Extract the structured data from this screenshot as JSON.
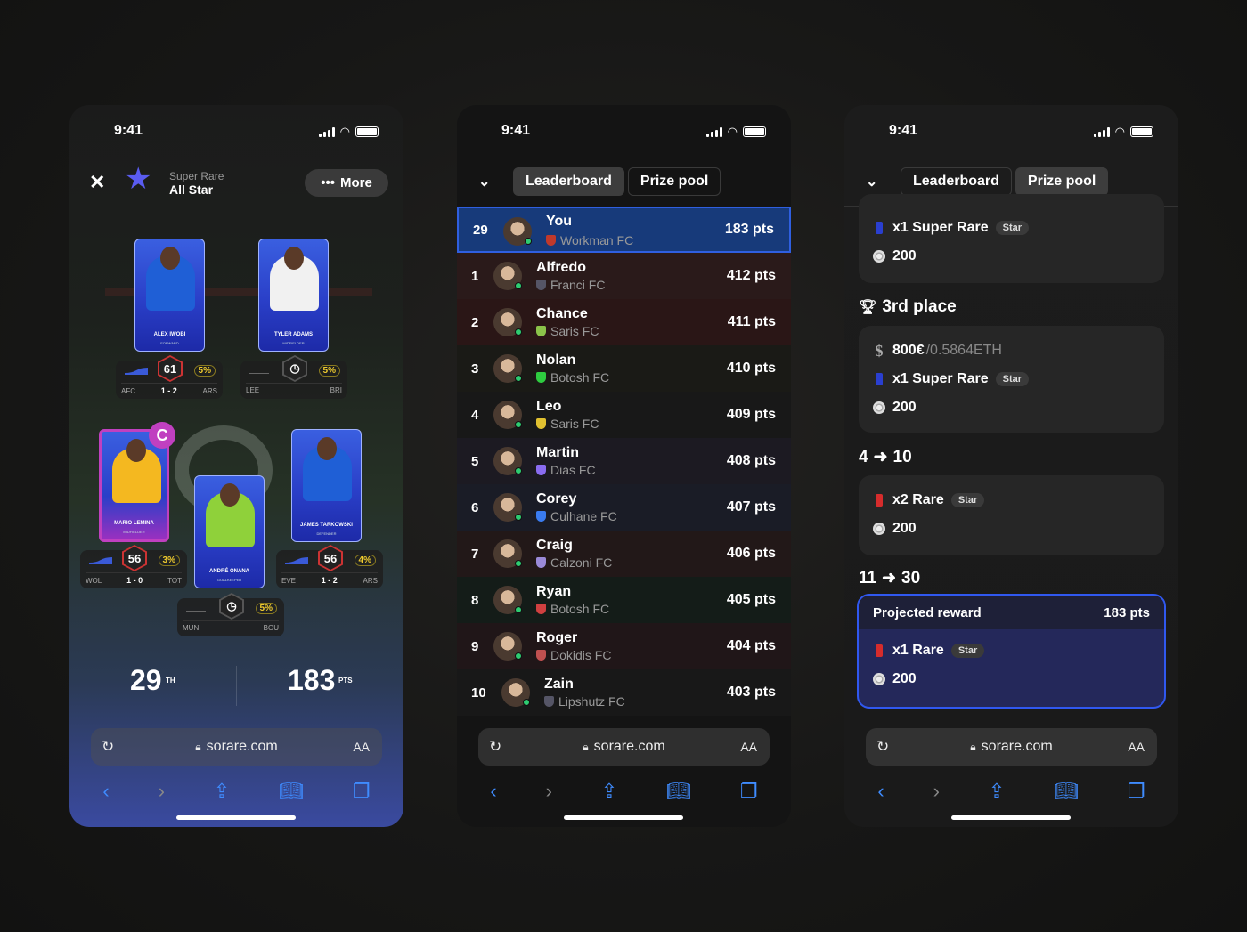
{
  "status": {
    "time": "9:41"
  },
  "browser": {
    "url": "sorare.com",
    "aa": "AA",
    "reload_icon": "reload-icon",
    "lock_icon": "lock-icon"
  },
  "lineup": {
    "rarity": "Super Rare",
    "competition": "All Star",
    "more_label": "More",
    "more_icon": "ellipsis-icon",
    "captain_badge": "C",
    "players": [
      {
        "name": "ALEX IWOBI",
        "position": "FORWARD",
        "score": "61",
        "pct": "5%",
        "home": "AFC",
        "result": "1 - 2",
        "away": "ARS",
        "jersey": "#1f5fd6"
      },
      {
        "name": "TYLER ADAMS",
        "position": "MIDFIELDER",
        "score": "",
        "pct": "5%",
        "home": "LEE",
        "result": "",
        "away": "BRI",
        "jersey": "#f1f1f1"
      },
      {
        "name": "MARIO LEMINA",
        "position": "MIDFIELDER",
        "score": "56",
        "pct": "3%",
        "home": "WOL",
        "result": "1 - 0",
        "away": "TOT",
        "jersey": "#f4b820"
      },
      {
        "name": "ANDRÉ ONANA",
        "position": "GOALKEEPER",
        "score": "",
        "pct": "5%",
        "home": "MUN",
        "result": "",
        "away": "BOU",
        "jersey": "#8fd13a"
      },
      {
        "name": "JAMES TARKOWSKI",
        "position": "DEFENDER",
        "score": "56",
        "pct": "4%",
        "home": "EVE",
        "result": "1 - 2",
        "away": "ARS",
        "jersey": "#1f5fd6"
      }
    ],
    "rank": "29",
    "rank_suffix": "TH",
    "points": "183",
    "points_suffix": "PTS"
  },
  "tabs": {
    "leaderboard": "Leaderboard",
    "prize_pool": "Prize pool"
  },
  "leaderboard": [
    {
      "rank": "29",
      "name": "You",
      "club": "Workman FC",
      "pts": "183 pts",
      "crest": "#c0392b",
      "me": true
    },
    {
      "rank": "1",
      "name": "Alfredo",
      "club": "Franci FC",
      "pts": "412 pts",
      "crest": "#556"
    },
    {
      "rank": "2",
      "name": "Chance",
      "club": "Saris FC",
      "pts": "411 pts",
      "crest": "#8bc34a"
    },
    {
      "rank": "3",
      "name": "Nolan",
      "club": "Botosh FC",
      "pts": "410 pts",
      "crest": "#2ecc40"
    },
    {
      "rank": "4",
      "name": "Leo",
      "club": "Saris FC",
      "pts": "409 pts",
      "crest": "#e0c030"
    },
    {
      "rank": "5",
      "name": "Martin",
      "club": "Dias FC",
      "pts": "408 pts",
      "crest": "#8a6cf0"
    },
    {
      "rank": "6",
      "name": "Corey",
      "club": "Culhane FC",
      "pts": "407 pts",
      "crest": "#3a7cf0"
    },
    {
      "rank": "7",
      "name": "Craig",
      "club": "Calzoni FC",
      "pts": "406 pts",
      "crest": "#9a8ad8"
    },
    {
      "rank": "8",
      "name": "Ryan",
      "club": "Botosh FC",
      "pts": "405 pts",
      "crest": "#d04040"
    },
    {
      "rank": "9",
      "name": "Roger",
      "club": "Dokidis FC",
      "pts": "404 pts",
      "crest": "#c05050"
    },
    {
      "rank": "10",
      "name": "Zain",
      "club": "Lipshutz FC",
      "pts": "403 pts",
      "crest": "#556"
    }
  ],
  "prize_pool": {
    "top_card": {
      "card": "x1 Super Rare",
      "tag": "Star",
      "coins": "200"
    },
    "third": {
      "title": "3rd place",
      "cash": "800€",
      "eth": "/0.5864ETH",
      "card": "x1 Super Rare",
      "tag": "Star",
      "coins": "200"
    },
    "range1": {
      "from": "4",
      "to": "10",
      "card": "x2 Rare",
      "tag": "Star",
      "coins": "200"
    },
    "range2": {
      "from": "11",
      "to": "30"
    },
    "projected": {
      "title": "Projected reward",
      "pts": "183 pts",
      "card": "x1 Rare",
      "tag": "Star",
      "coins": "200"
    }
  },
  "colors": {
    "accent": "#2f5fe0",
    "positive": "#2ecc71",
    "pct": "#f1cc2e",
    "score_ring": "#cc3333"
  }
}
